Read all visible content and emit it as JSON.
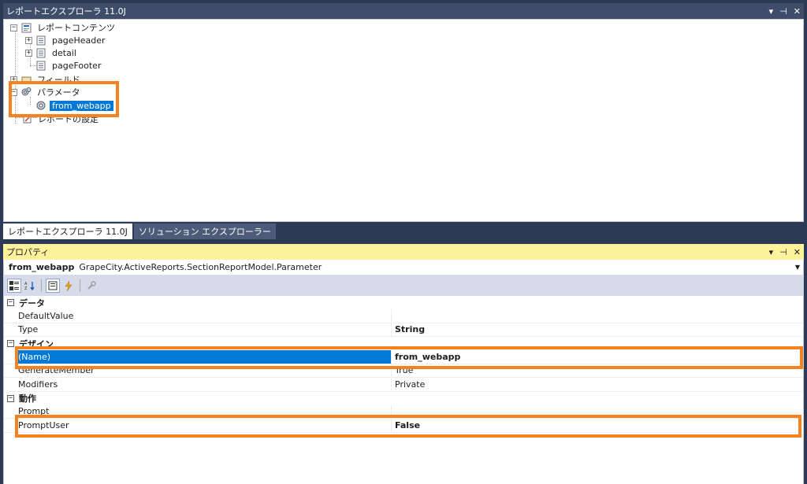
{
  "report_explorer": {
    "title": "レポートエクスプローラ 11.0J",
    "controls": {
      "pin": "ᅮ",
      "close": "✕",
      "menu": "▾"
    },
    "tree": {
      "contents": "レポートコンテンツ",
      "page_header": "pageHeader",
      "detail": "detail",
      "page_footer": "pageFooter",
      "fields": "フィールド",
      "parameters": "パラメータ",
      "param_item": "from_webapp",
      "settings": "レポートの設定"
    }
  },
  "tabs": [
    {
      "label": "レポートエクスプローラ 11.0J"
    },
    {
      "label": "ソリューション エクスプローラー"
    }
  ],
  "properties": {
    "title": "プロパティ",
    "object_name": "from_webapp",
    "object_type": "GrapeCity.ActiveReports.SectionReportModel.Parameter",
    "categories": [
      {
        "label": "データ",
        "rows": [
          {
            "name": "DefaultValue",
            "value": ""
          },
          {
            "name": "Type",
            "value": "String"
          }
        ]
      },
      {
        "label": "デザイン",
        "rows": [
          {
            "name": "(Name)",
            "value": "from_webapp"
          },
          {
            "name": "GenerateMember",
            "value": "True"
          },
          {
            "name": "Modifiers",
            "value": "Private"
          }
        ]
      },
      {
        "label": "動作",
        "rows": [
          {
            "name": "Prompt",
            "value": ""
          },
          {
            "name": "PromptUser",
            "value": "False"
          }
        ]
      }
    ]
  },
  "colors": {
    "accent_highlight": "#f5821f",
    "selection": "#0078d7",
    "properties_title_bg": "#fff29d",
    "window_chrome": "#2d3a55"
  }
}
